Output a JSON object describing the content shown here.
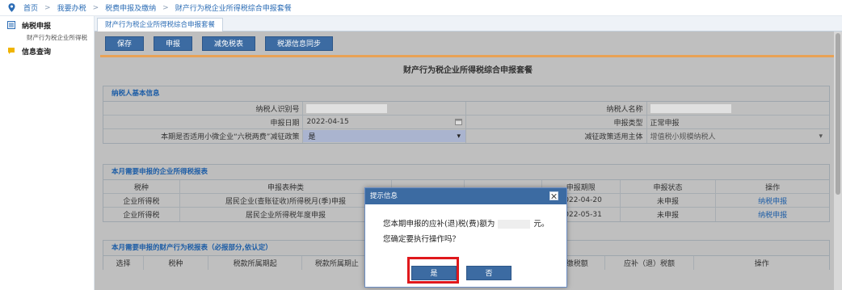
{
  "breadcrumb": {
    "items": [
      "首页",
      "我要办税",
      "税费申报及缴纳",
      "财产行为税企业所得税综合申报套餐"
    ],
    "separator": ">"
  },
  "sidebar": {
    "groups": [
      {
        "label": "纳税申报",
        "icon": "list-icon",
        "sub": [
          "财产行为税企业所得税"
        ]
      },
      {
        "label": "信息查询",
        "icon": "chat-icon",
        "sub": []
      }
    ]
  },
  "tab": {
    "label": "财产行为税企业所得税综合申报套餐"
  },
  "toolbar": {
    "buttons": [
      "保存",
      "申报",
      "减免税表",
      "税源信息同步"
    ]
  },
  "form_title": "财产行为税企业所得税综合申报套餐",
  "basic_info": {
    "title": "纳税人基本信息",
    "taxpayer_id_label": "纳税人识别号",
    "taxpayer_name_label": "纳税人名称",
    "declare_date_label": "申报日期",
    "declare_date_value": "2022-04-15",
    "declare_type_label": "申报类型",
    "declare_type_value": "正常申报",
    "policy_label": "本期是否适用小微企业“六税两费”减征政策",
    "policy_value": "是",
    "subject_label": "减征政策适用主体",
    "subject_value": "增值税小规模纳税人"
  },
  "income_tax_section": {
    "title": "本月需要申报的企业所得税报表",
    "headers": [
      "税种",
      "申报表种类",
      "",
      "",
      "申报期限",
      "申报状态",
      "操作"
    ],
    "rows": [
      {
        "tax": "企业所得税",
        "form": "居民企业(查账征收)所得税月(季)申报",
        "deadline": "2022-04-20",
        "status": "未申报",
        "action": "纳税申报"
      },
      {
        "tax": "企业所得税",
        "form": "居民企业所得税年度申报",
        "deadline": "2022-05-31",
        "status": "未申报",
        "action": "纳税申报"
      }
    ]
  },
  "property_section": {
    "title": "本月需要申报的财产行为税报表（必报部分,依认定）",
    "headers": [
      "选择",
      "税种",
      "税款所属期起",
      "税款所属期止",
      "",
      "",
      "已缴税额",
      "应补（退）税额",
      "操作"
    ]
  },
  "modal": {
    "title": "提示信息",
    "line1_prefix": "您本期申报的应补(退)税(费)额为",
    "line1_suffix": "元。",
    "line2": "您确定要执行操作吗？",
    "yes": "是",
    "no": "否"
  },
  "colors": {
    "primary": "#3c6ba2",
    "link": "#1d5da6",
    "accent": "#e9a255",
    "highlight_box": "#e0181c"
  }
}
